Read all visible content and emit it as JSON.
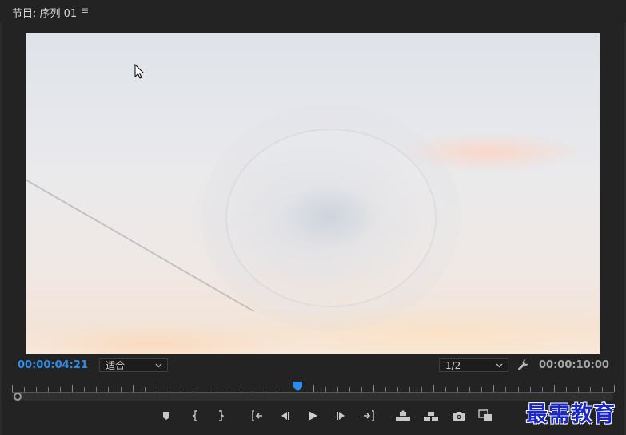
{
  "panel": {
    "title": "节目: 序列 01",
    "menu_glyph": "≡"
  },
  "viewer": {
    "current_timecode": "00:00:04:21",
    "duration_timecode": "00:00:10:00",
    "zoom_level": "适合",
    "resolution": "1/2",
    "playhead_position_fraction": 0.475
  },
  "transport": {
    "buttons": [
      {
        "name": "add-marker-button",
        "icon": "marker-icon"
      },
      {
        "name": "mark-in-button",
        "icon": "mark-in-icon"
      },
      {
        "name": "mark-out-button",
        "icon": "mark-out-icon"
      },
      {
        "name": "go-to-in-button",
        "icon": "go-to-in-icon"
      },
      {
        "name": "step-back-button",
        "icon": "step-back-icon"
      },
      {
        "name": "play-button",
        "icon": "play-icon"
      },
      {
        "name": "step-forward-button",
        "icon": "step-forward-icon"
      },
      {
        "name": "go-to-out-button",
        "icon": "go-to-out-icon"
      },
      {
        "name": "lift-button",
        "icon": "lift-icon"
      },
      {
        "name": "extract-button",
        "icon": "extract-icon"
      },
      {
        "name": "export-frame-button",
        "icon": "camera-icon"
      },
      {
        "name": "comparison-view-button",
        "icon": "comparison-icon"
      }
    ]
  },
  "watermark": {
    "text": "最需教育"
  },
  "colors": {
    "timecode_current": "#2d8ceb",
    "playhead": "#2d8ceb",
    "panel_bg": "#232323"
  }
}
